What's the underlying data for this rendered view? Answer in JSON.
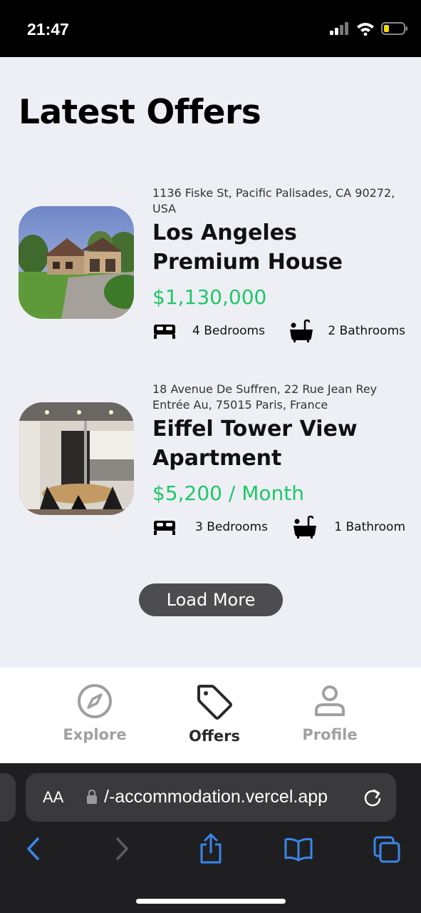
{
  "status": {
    "time": "21:47"
  },
  "page": {
    "title": "Latest Offers"
  },
  "offers": [
    {
      "address": "1136 Fiske St, Pacific Palisades, CA 90272, USA",
      "name": "Los Angeles Premium House",
      "price": "$1,130,000",
      "bedrooms": "4 Bedrooms",
      "bathrooms": "2 Bathrooms",
      "image_icon": "house-photo"
    },
    {
      "address": "18 Avenue De Suffren, 22 Rue Jean Rey Entrée Au, 75015 Paris, France",
      "name": "Eiffel Tower View Apartment",
      "price": "$5,200 / Month",
      "bedrooms": "3 Bedrooms",
      "bathrooms": "1 Bathroom",
      "image_icon": "apartment-photo"
    }
  ],
  "load_more": "Load More",
  "tabs": [
    {
      "label": "Explore",
      "icon": "compass-icon",
      "active": false
    },
    {
      "label": "Offers",
      "icon": "tag-icon",
      "active": true
    },
    {
      "label": "Profile",
      "icon": "user-icon",
      "active": false
    }
  ],
  "browser": {
    "aa": "AA",
    "url": "/-accommodation.vercel.app"
  },
  "colors": {
    "price": "#1fc767",
    "button": "#4d4d4f",
    "background": "#eeeff5",
    "browser_accent": "#3a86e8"
  }
}
